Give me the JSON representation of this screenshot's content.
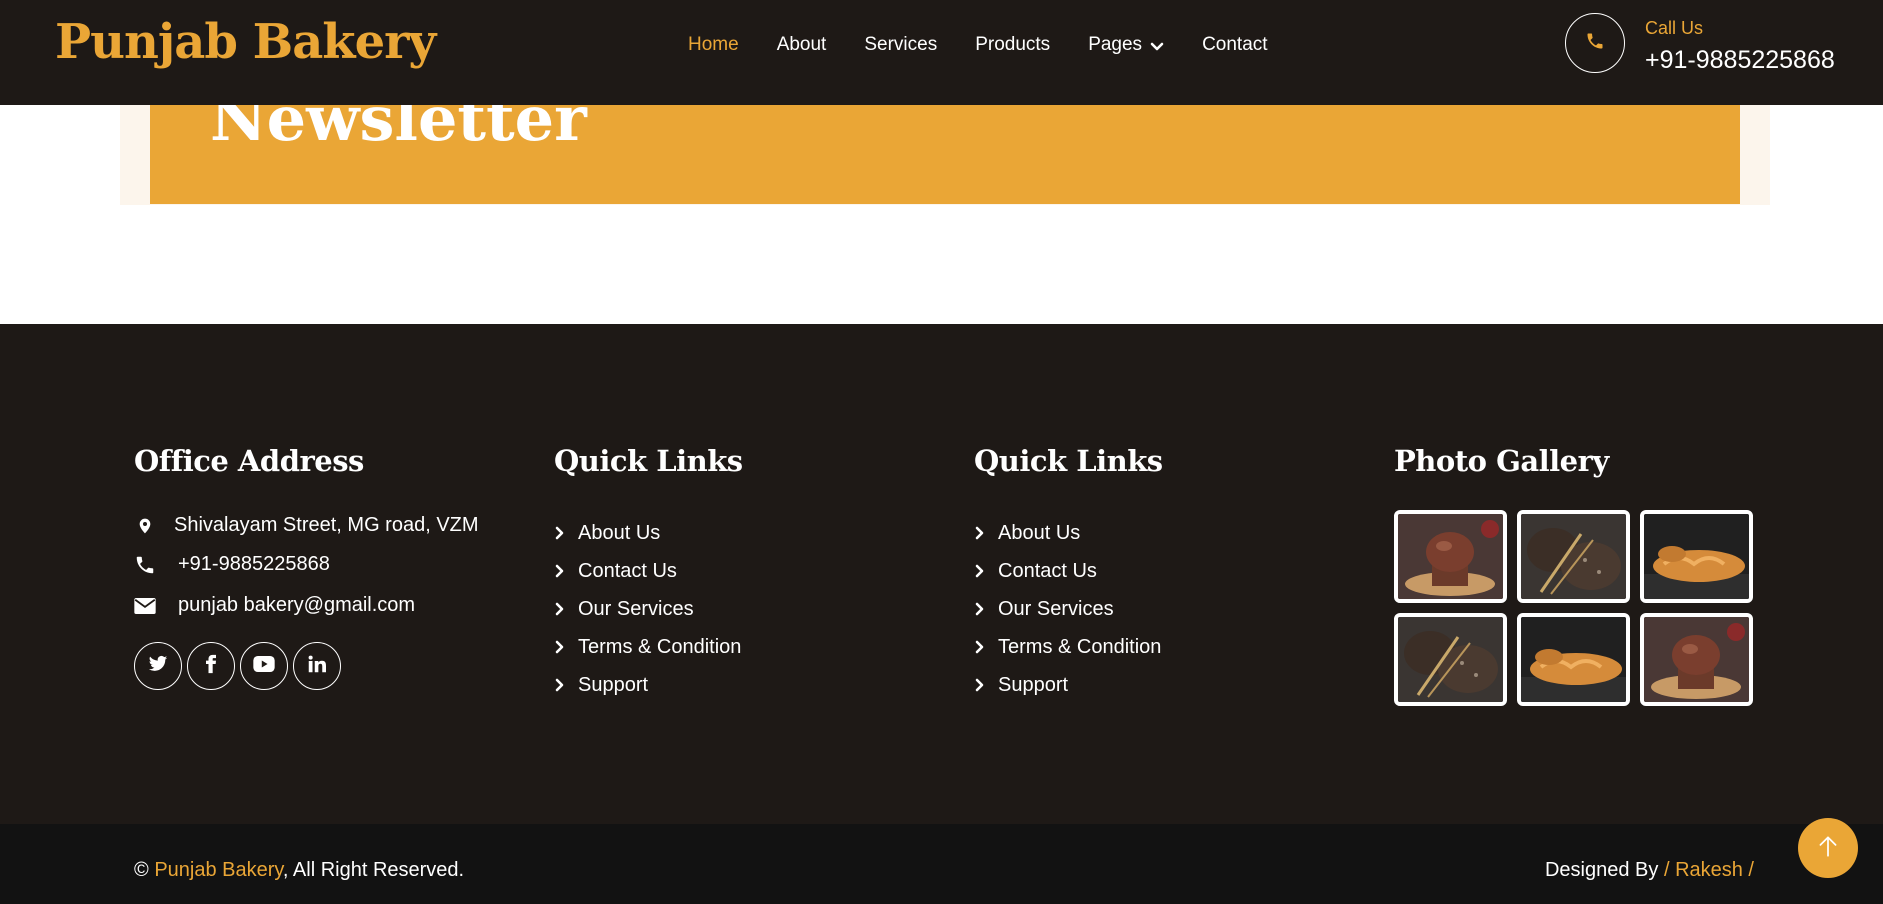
{
  "header": {
    "brand": "Punjab Bakery",
    "nav": [
      {
        "label": "Home",
        "active": true
      },
      {
        "label": "About"
      },
      {
        "label": "Services"
      },
      {
        "label": "Products"
      },
      {
        "label": "Pages",
        "has_dropdown": true
      },
      {
        "label": "Contact"
      }
    ],
    "call_label": "Call Us",
    "call_number": "+91-9885225868",
    "call_icon": "phone-icon"
  },
  "newsletter": {
    "title": "Newsletter"
  },
  "footer": {
    "office": {
      "title": "Office Address",
      "address": "Shivalayam Street, MG road, VZM",
      "phone": "+91-9885225868",
      "email": "punjab bakery@gmail.com",
      "social": [
        "twitter-icon",
        "facebook-icon",
        "youtube-icon",
        "linkedin-icon"
      ]
    },
    "quick_links_1": {
      "title": "Quick Links",
      "items": [
        "About Us",
        "Contact Us",
        "Our Services",
        "Terms & Condition",
        "Support"
      ]
    },
    "quick_links_2": {
      "title": "Quick Links",
      "items": [
        "About Us",
        "Contact Us",
        "Our Services",
        "Terms & Condition",
        "Support"
      ]
    },
    "gallery": {
      "title": "Photo Gallery",
      "images": [
        "muffin",
        "rye-bread",
        "croissant",
        "rye-bread",
        "croissant",
        "muffin"
      ]
    }
  },
  "copyright": {
    "symbol": "©",
    "brand": "Punjab Bakery",
    "suffix": ", All Right Reserved.",
    "designed_by_label": "Designed By",
    "designer": "/ Rakesh /"
  },
  "colors": {
    "accent": "#eaa636",
    "dark": "#1e1916",
    "darker": "#121212"
  }
}
